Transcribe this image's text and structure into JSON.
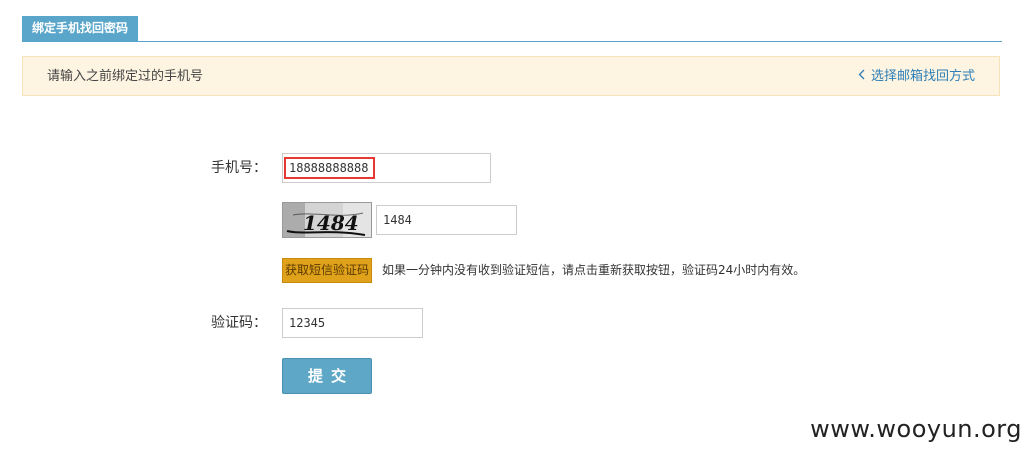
{
  "tab": {
    "label": "绑定手机找回密码"
  },
  "notice": {
    "text": "请输入之前绑定过的手机号",
    "link_label": "选择邮箱找回方式",
    "link_icon": "chevron-left-icon"
  },
  "form": {
    "phone_label": "手机号：",
    "phone_value": "18888888888",
    "captcha_image_text": "1484",
    "captcha_value": "1484",
    "sms_button_label": "获取短信验证码",
    "sms_hint": "如果一分钟内没有收到验证短信，请点击重新获取按钮，验证码24小时内有效。",
    "code_label": "验证码：",
    "code_value": "12345",
    "submit_label": "提交"
  },
  "watermark": "www.wooyun.org",
  "colors": {
    "tab_bg": "#5aa6cb",
    "notice_bg": "#fdf4e2",
    "link": "#2f7fb6",
    "sms_button": "#e0a21a",
    "submit_button": "#5fa7c6",
    "highlight": "#e53935"
  }
}
